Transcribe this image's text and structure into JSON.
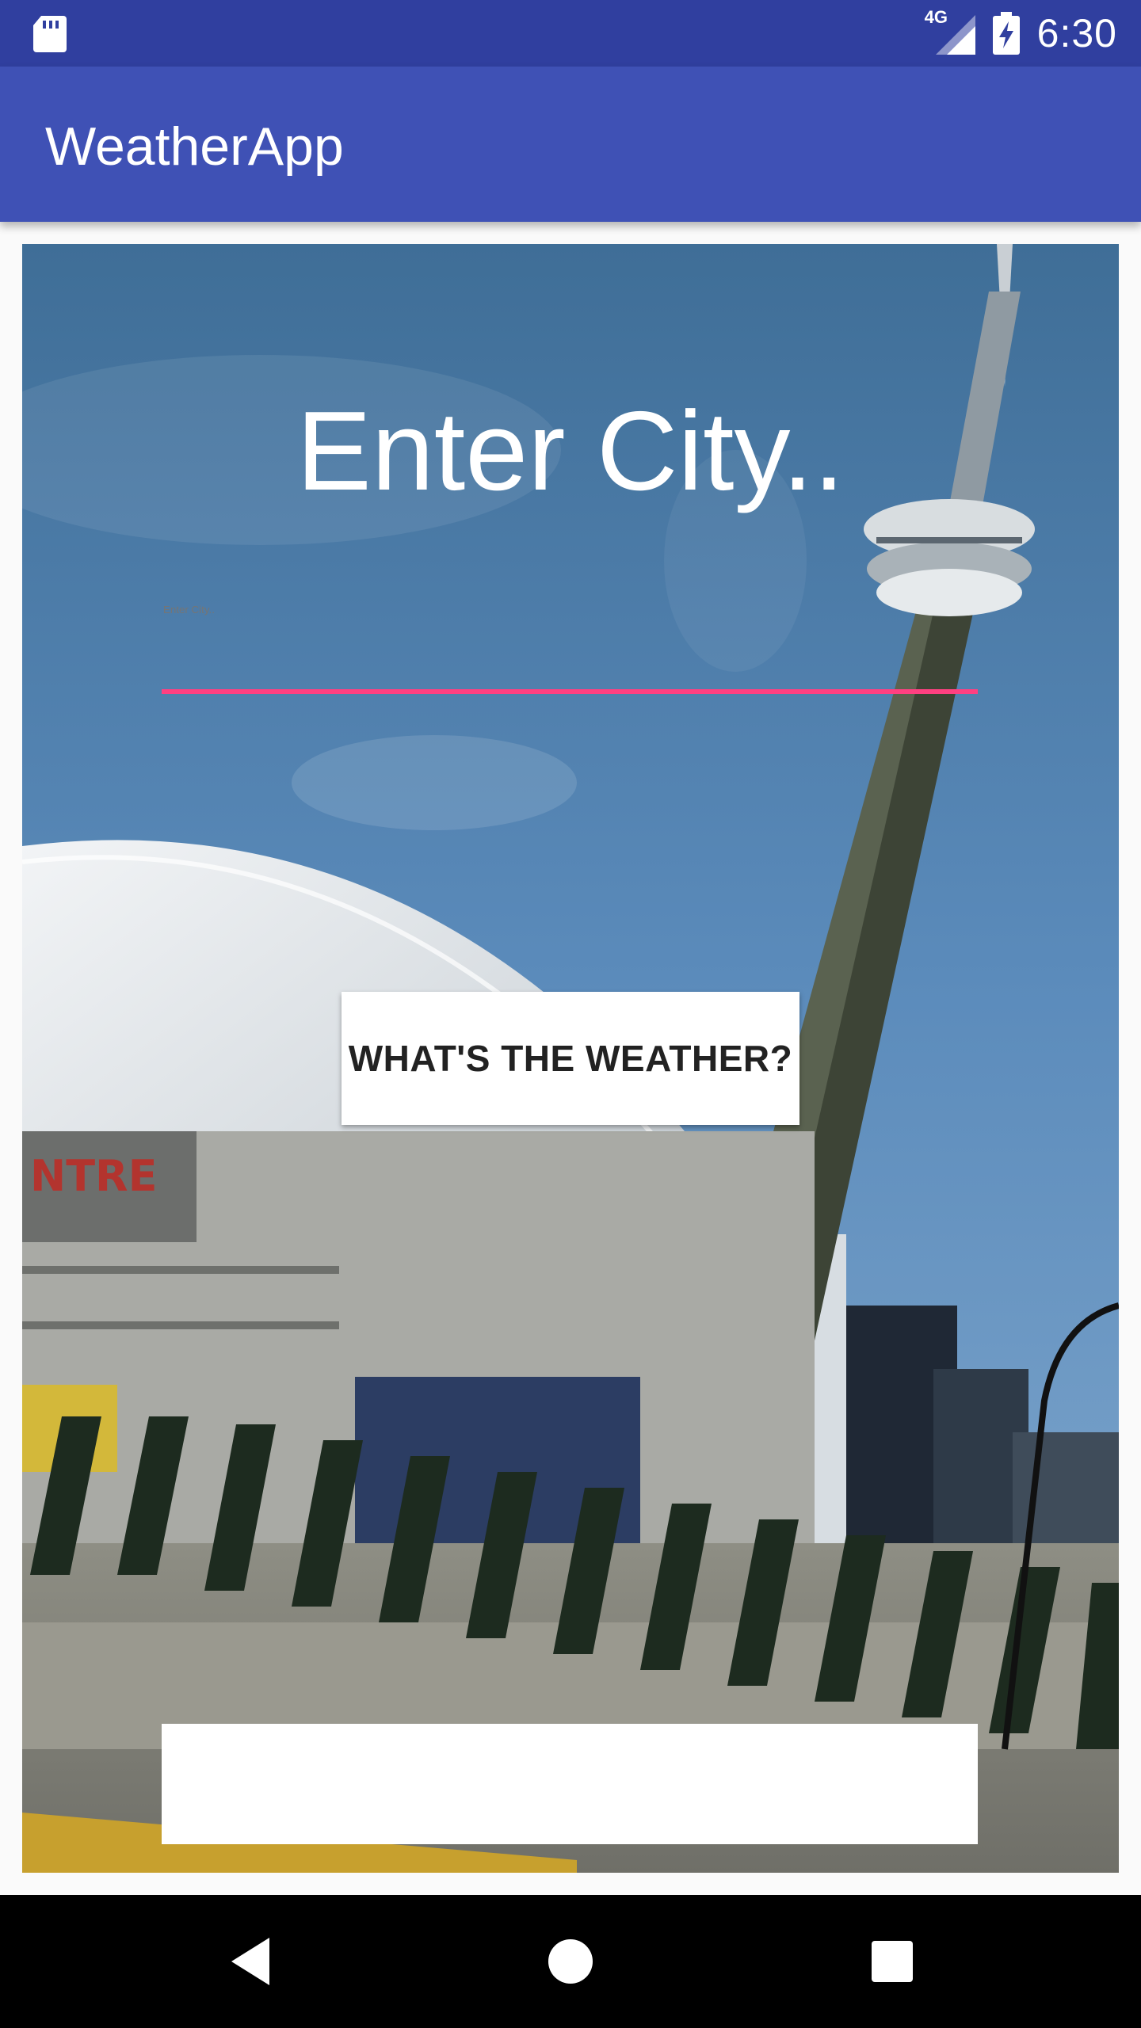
{
  "status_bar": {
    "time": "6:30",
    "network": "4G",
    "icons": [
      "sd-card-icon",
      "signal-icon",
      "battery-charging-icon"
    ]
  },
  "app_bar": {
    "title": "WeatherApp"
  },
  "main": {
    "city_input": {
      "placeholder": "Enter City..",
      "value": ""
    },
    "weather_button": {
      "label": "WHAT'S THE WEATHER?"
    },
    "result_text": "",
    "background": "toronto-skyline-photo"
  },
  "nav_bar": {
    "icons": [
      "back-icon",
      "home-icon",
      "recents-icon"
    ]
  },
  "colors": {
    "status_bar": "#303f9f",
    "app_bar": "#3f51b5",
    "accent": "#ff4081",
    "button_bg": "#ffffff",
    "nav_bar": "#000000"
  }
}
